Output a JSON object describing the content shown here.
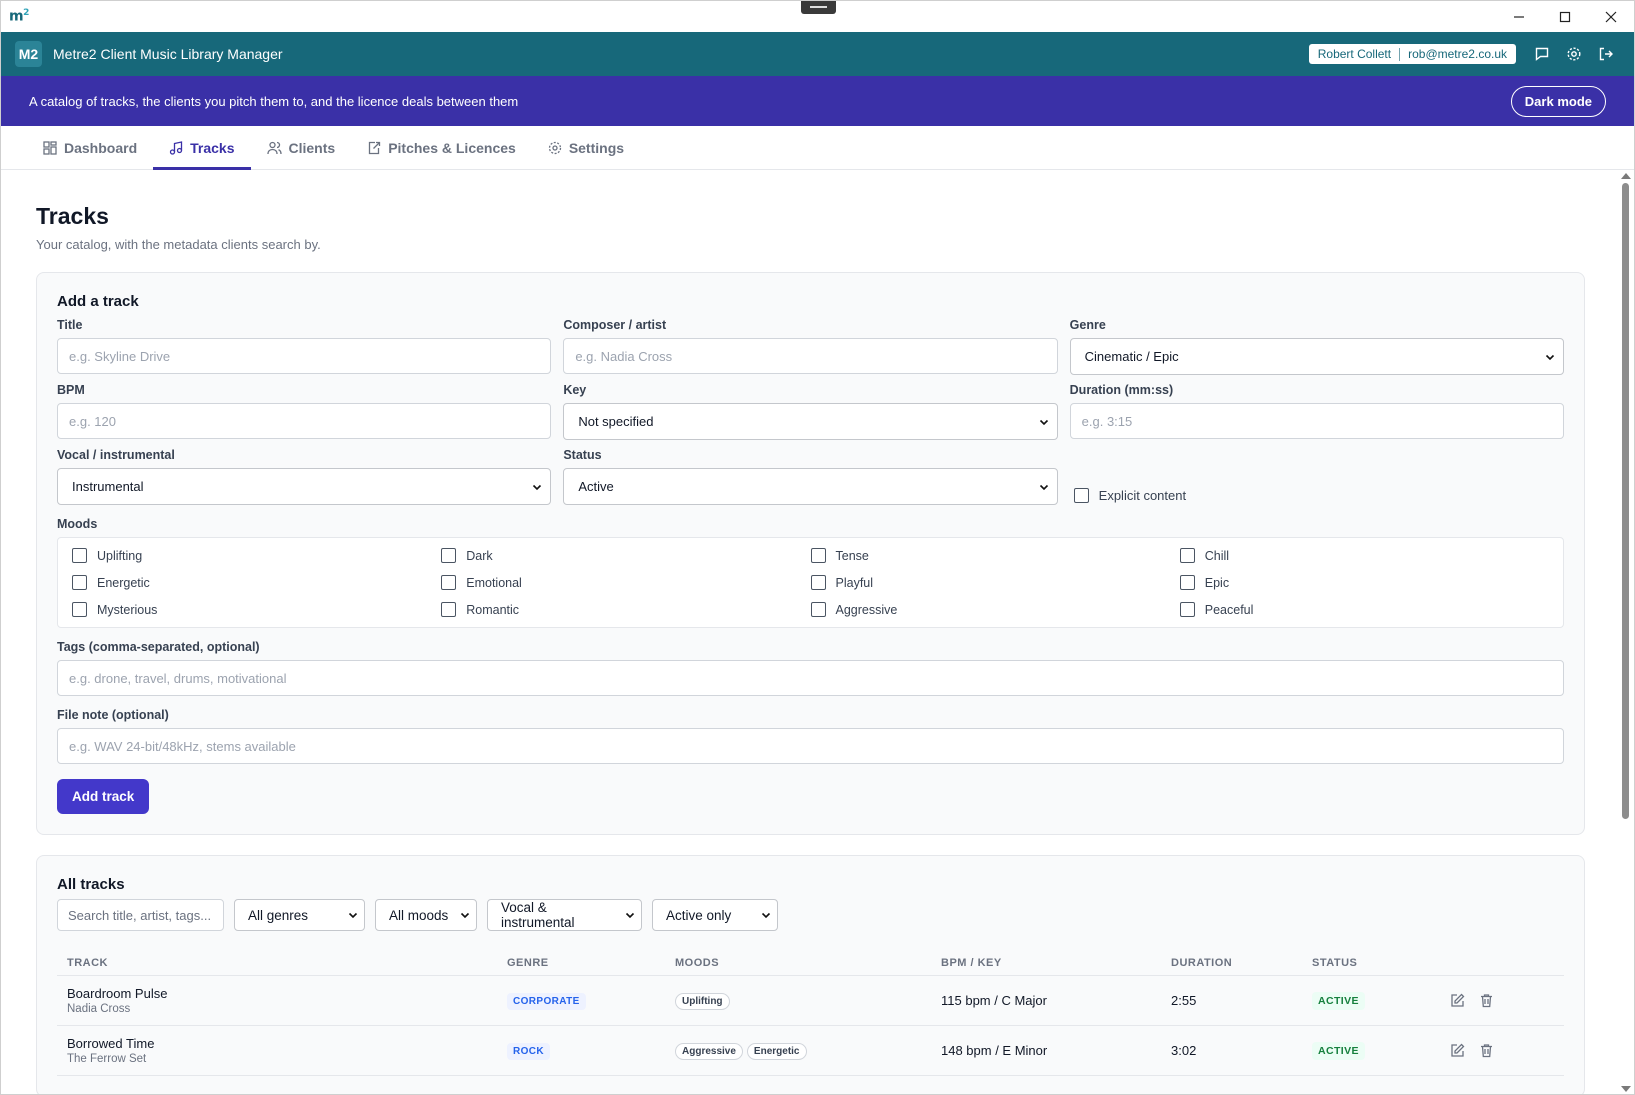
{
  "window": {
    "logo": "m",
    "logo_sup": "2"
  },
  "app": {
    "badge": "M2",
    "title": "Metre2 Client Music Library Manager",
    "user_name": "Robert Collett",
    "user_email": "rob@metre2.co.uk"
  },
  "banner": {
    "text": "A catalog of tracks, the clients you pitch them to, and the licence deals between them",
    "dark_mode_label": "Dark mode"
  },
  "tabs": [
    {
      "label": "Dashboard",
      "icon": "grid-icon"
    },
    {
      "label": "Tracks",
      "icon": "music-note-icon",
      "active": true
    },
    {
      "label": "Clients",
      "icon": "users-icon"
    },
    {
      "label": "Pitches & Licences",
      "icon": "send-icon"
    },
    {
      "label": "Settings",
      "icon": "gear-icon"
    }
  ],
  "page": {
    "title": "Tracks",
    "subtitle": "Your catalog, with the metadata clients search by."
  },
  "add_form": {
    "heading": "Add a track",
    "title_label": "Title",
    "title_placeholder": "e.g. Skyline Drive",
    "composer_label": "Composer / artist",
    "composer_placeholder": "e.g. Nadia Cross",
    "genre_label": "Genre",
    "genre_value": "Cinematic / Epic",
    "bpm_label": "BPM",
    "bpm_placeholder": "e.g. 120",
    "key_label": "Key",
    "key_value": "Not specified",
    "duration_label": "Duration (mm:ss)",
    "duration_placeholder": "e.g. 3:15",
    "vocal_label": "Vocal / instrumental",
    "vocal_value": "Instrumental",
    "status_label": "Status",
    "status_value": "Active",
    "explicit_label": "Explicit content",
    "moods_label": "Moods",
    "moods": [
      "Uplifting",
      "Dark",
      "Tense",
      "Chill",
      "Energetic",
      "Emotional",
      "Playful",
      "Epic",
      "Mysterious",
      "Romantic",
      "Aggressive",
      "Peaceful"
    ],
    "tags_label": "Tags (comma-separated, optional)",
    "tags_placeholder": "e.g. drone, travel, drums, motivational",
    "filenote_label": "File note (optional)",
    "filenote_placeholder": "e.g. WAV 24-bit/48kHz, stems available",
    "submit_label": "Add track"
  },
  "all_tracks": {
    "heading": "All tracks",
    "search_placeholder": "Search title, artist, tags...",
    "filter_genre": "All genres",
    "filter_mood": "All moods",
    "filter_vocal": "Vocal & instrumental",
    "filter_status": "Active only",
    "columns": [
      "TRACK",
      "GENRE",
      "MOODS",
      "BPM / KEY",
      "DURATION",
      "STATUS"
    ],
    "rows": [
      {
        "title": "Boardroom Pulse",
        "artist": "Nadia Cross",
        "genre": "CORPORATE",
        "moods": [
          "Uplifting"
        ],
        "bpm_key": "115 bpm / C Major",
        "duration": "2:55",
        "status": "ACTIVE"
      },
      {
        "title": "Borrowed Time",
        "artist": "The Ferrow Set",
        "genre": "ROCK",
        "moods": [
          "Aggressive",
          "Energetic"
        ],
        "bpm_key": "148 bpm / E Minor",
        "duration": "3:02",
        "status": "ACTIVE"
      }
    ]
  }
}
